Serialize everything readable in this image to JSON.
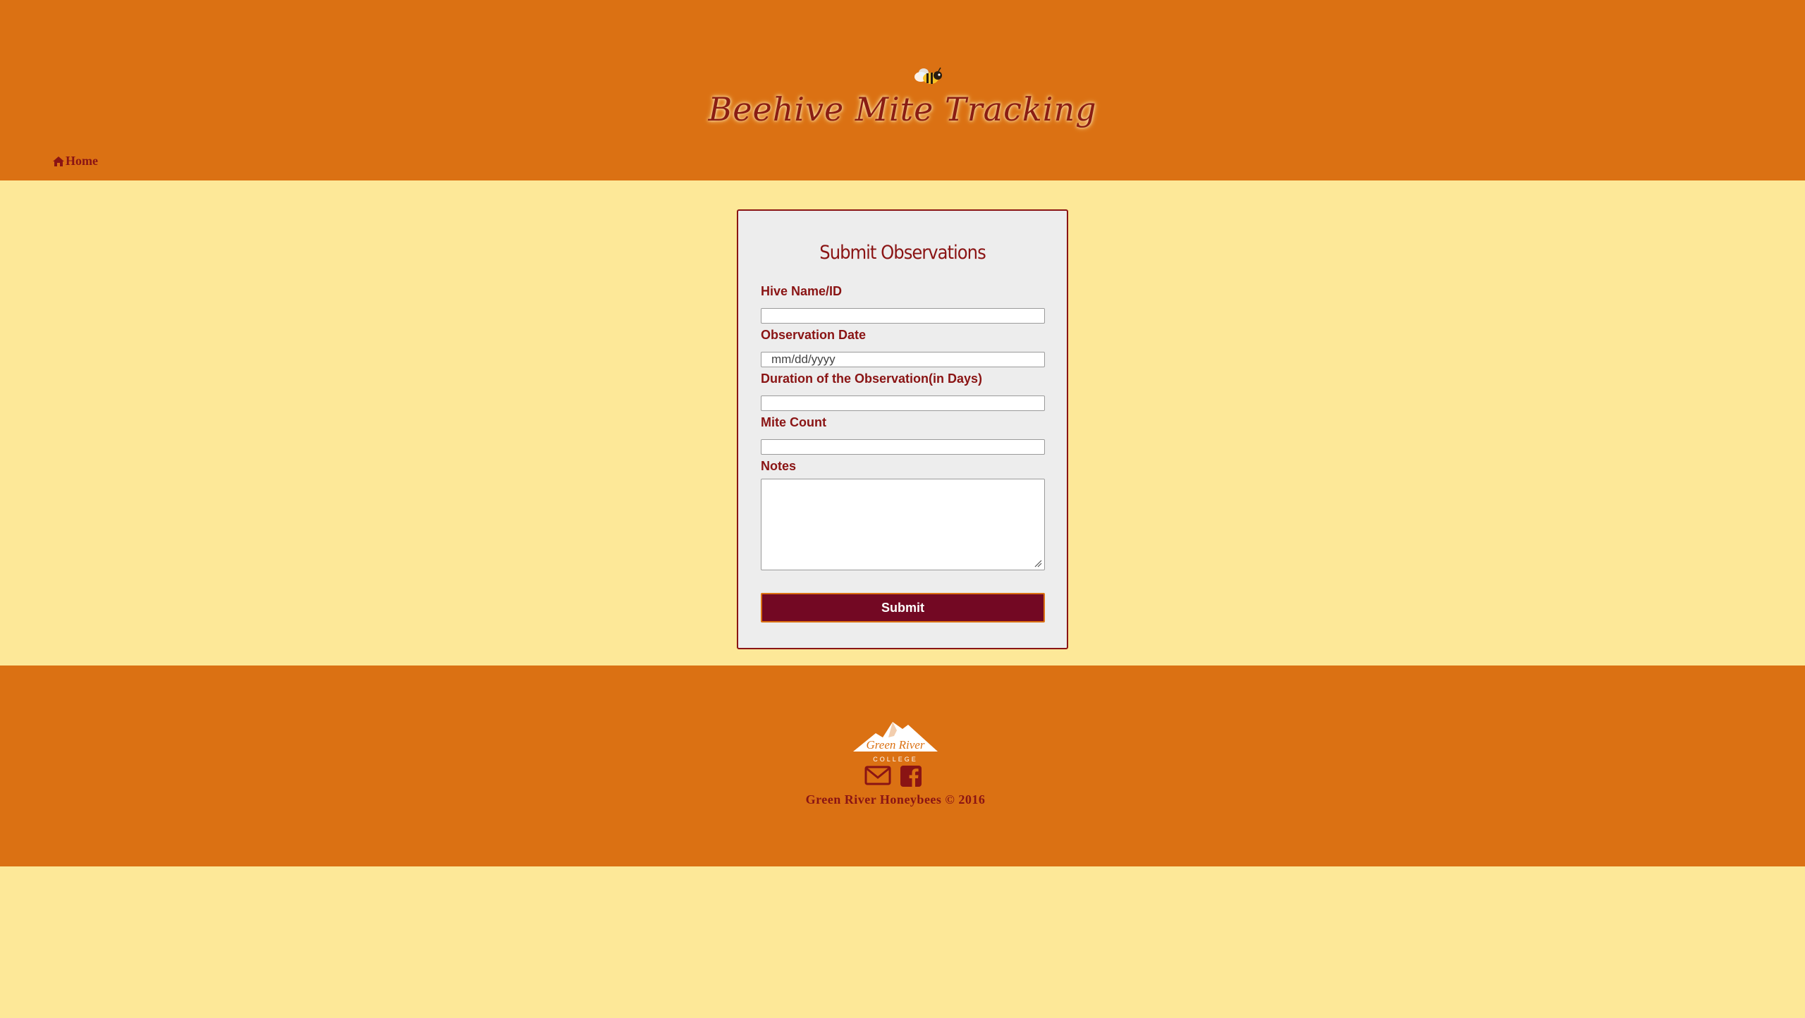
{
  "header": {
    "title": "Beehive Mite Tracking",
    "bee_logo_icon": "bee-icon",
    "nav": {
      "home_label": "Home",
      "home_icon": "home-icon"
    }
  },
  "form": {
    "heading": "Submit Observations",
    "fields": [
      {
        "label": "Hive Name/ID",
        "value": "",
        "placeholder": ""
      },
      {
        "label": "Observation Date",
        "value": "",
        "placeholder": "mm/dd/yyyy"
      },
      {
        "label": "Duration of the Observation(in Days)",
        "value": "",
        "placeholder": ""
      },
      {
        "label": "Mite Count",
        "value": "",
        "placeholder": ""
      }
    ],
    "notes_label": "Notes",
    "notes_value": "",
    "submit_label": "Submit"
  },
  "footer": {
    "college_logo_text": "Green River",
    "college_logo_subtext": "COLLEGE",
    "icons": [
      "envelope-icon",
      "facebook-icon"
    ],
    "copyright": "Green River Honeybees © 2016"
  },
  "colors": {
    "header_bg": "#db7113",
    "page_bg": "#fde898",
    "accent_text": "#8a1414",
    "button_bg": "#730823",
    "card_bg": "#ededed"
  }
}
